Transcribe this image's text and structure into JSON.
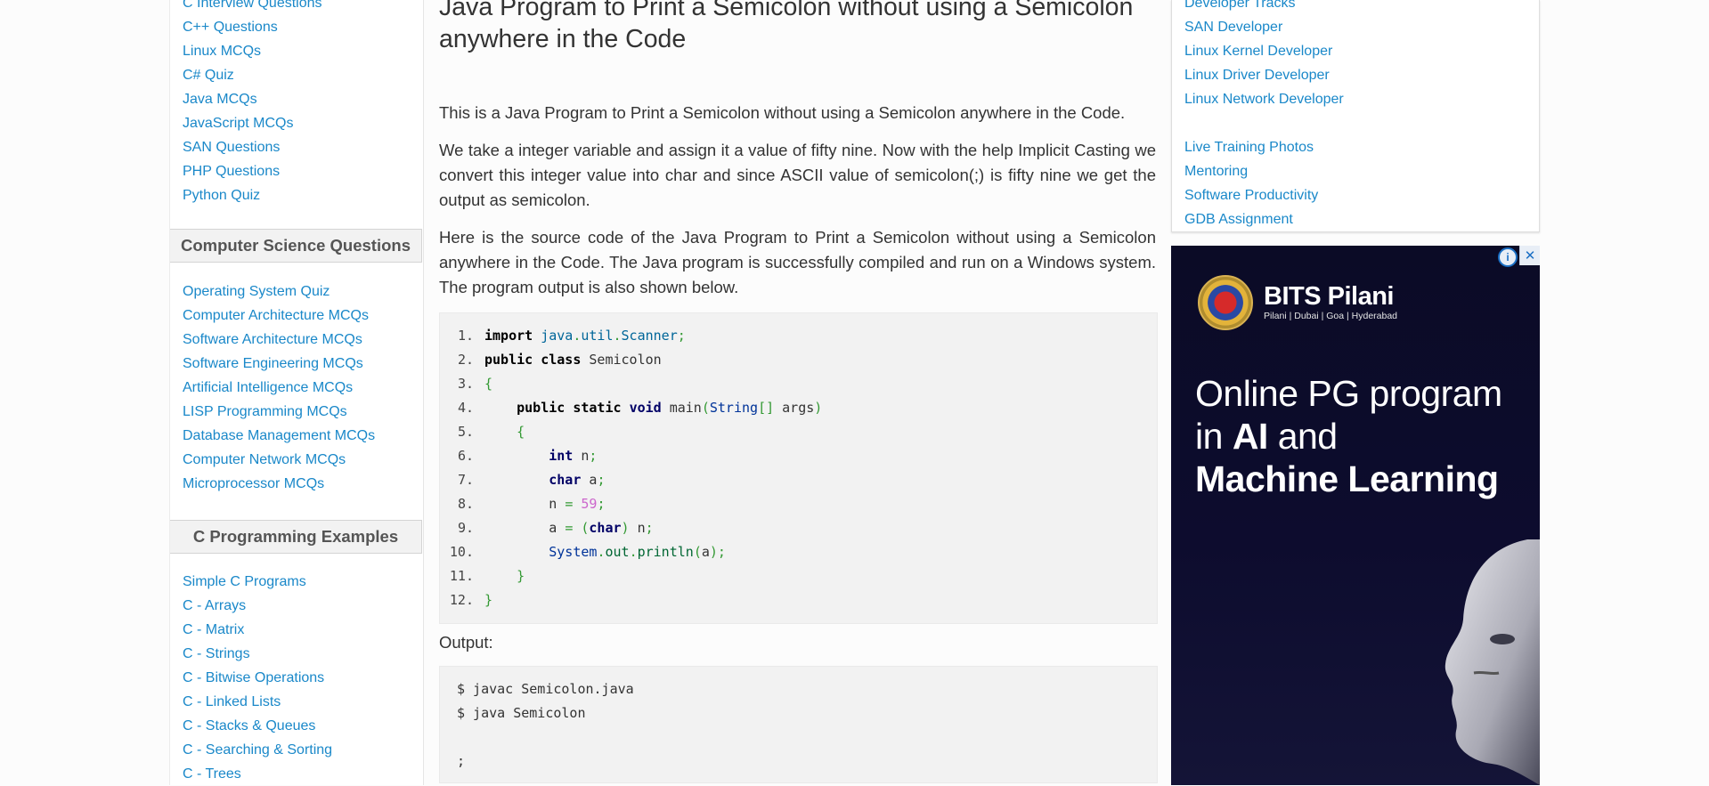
{
  "left_sidebar": {
    "top_links": [
      "C Interview Questions",
      "C++ Questions",
      "Linux MCQs",
      "C# Quiz",
      "Java MCQs",
      "JavaScript MCQs",
      "SAN Questions",
      "PHP Questions",
      "Python Quiz"
    ],
    "cs_heading": "Computer Science Questions",
    "cs_links": [
      "Operating System Quiz",
      "Computer Architecture MCQs",
      "Software Architecture MCQs",
      "Software Engineering MCQs",
      "Artificial Intelligence MCQs",
      "LISP Programming MCQs",
      "Database Management MCQs",
      "Computer Network MCQs",
      "Microprocessor MCQs"
    ],
    "c_heading": "C Programming Examples",
    "c_links": [
      "Simple C Programs",
      "C - Arrays",
      "C - Matrix",
      "C - Strings",
      "C - Bitwise Operations",
      "C - Linked Lists",
      "C - Stacks & Queues",
      "C - Searching & Sorting",
      "C - Trees"
    ]
  },
  "main": {
    "title": "Java Program to Print a Semicolon without using a Semicolon anywhere in the Code",
    "para1": "This is a Java Program to Print a Semicolon without using a Semicolon anywhere in the Code.",
    "para2": "We take a integer variable and assign it a value of fifty nine. Now with the help Implicit Casting we convert this integer value into char and since ASCII value of semicolon(;) is fifty nine we get the output as semicolon.",
    "para3": "Here is the source code of the Java Program to Print a Semicolon without using a Semicolon anywhere in the Code. The Java program is successfully compiled and run on a Windows system. The program output is also shown below.",
    "code_line_numbers": [
      "1.",
      "2.",
      "3.",
      "4.",
      "5.",
      "6.",
      "7.",
      "8.",
      "9.",
      "10.",
      "11.",
      "12."
    ],
    "output_label": "Output:",
    "output_lines": [
      "$ javac Semicolon.java",
      "$ java Semicolon",
      "",
      ";"
    ]
  },
  "right_sidebar": {
    "links": [
      "Developer Tracks",
      "SAN Developer",
      "Linux Kernel Developer",
      "Linux Driver Developer",
      "Linux Network Developer",
      "",
      "Live Training Photos",
      "Mentoring",
      "Software Productivity",
      "GDB Assignment"
    ]
  },
  "ad": {
    "info_icon": "i",
    "close_icon": "✕",
    "brand": "BITS Pilani",
    "campuses": "Pilani | Dubai | Goa | Hyderabad",
    "headline_1": "Online PG program",
    "headline_2a": "in ",
    "headline_2b": "AI",
    "headline_2c": " and",
    "headline_3": "Machine Learning",
    "colors": {
      "background": "#0d0c2e",
      "text": "#ffffff"
    }
  },
  "colors": {
    "link": "#1a88c9",
    "code_bg": "#f2f2f2",
    "page_bg": "#fcfcfc"
  }
}
